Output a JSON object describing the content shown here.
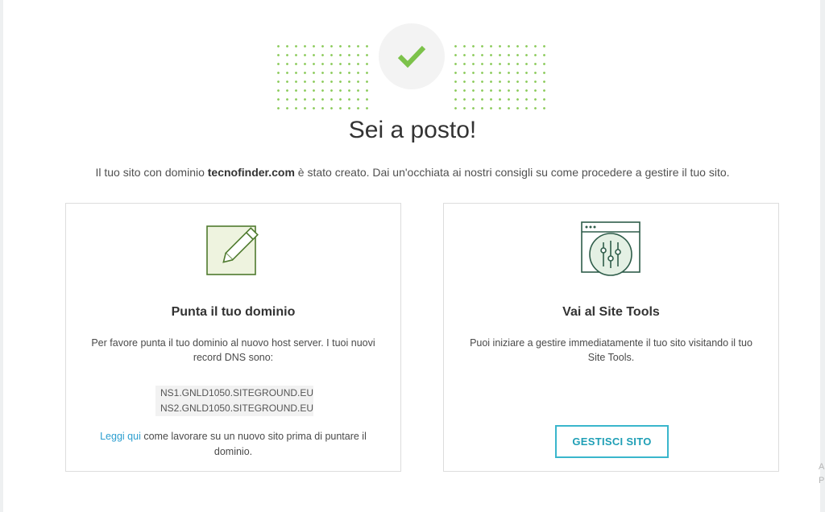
{
  "header": {
    "title": "Sei a posto!",
    "subtitle_prefix": "Il tuo sito con dominio ",
    "domain": "tecnofinder.com",
    "subtitle_suffix": " è stato creato. Dai un'occhiata ai nostri consigli su come procedere a gestire il tuo sito."
  },
  "cards": {
    "domain": {
      "icon": "edit-note-icon",
      "title": "Punta il tuo dominio",
      "text": "Per favore punta il tuo dominio al nuovo host server. I tuoi nuovi record DNS sono:",
      "dns_records": [
        "NS1.GNLD1050.SITEGROUND.EU",
        "NS2.GNLD1050.SITEGROUND.EU"
      ],
      "link_label": "Leggi qui",
      "note_suffix": " come lavorare su un nuovo sito prima di puntare il dominio."
    },
    "site_tools": {
      "icon": "site-tools-settings-icon",
      "title": "Vai al Site Tools",
      "text": "Puoi iniziare a gestire immediatamente il tuo sito visitando il tuo Site Tools.",
      "button_label": "GESTISCI SITO"
    }
  },
  "edge": {
    "line1": "A",
    "line2": "P"
  },
  "colors": {
    "accent_green": "#8bcb5a",
    "button_teal": "#3ab6cc",
    "link_blue": "#2d9fd0"
  }
}
